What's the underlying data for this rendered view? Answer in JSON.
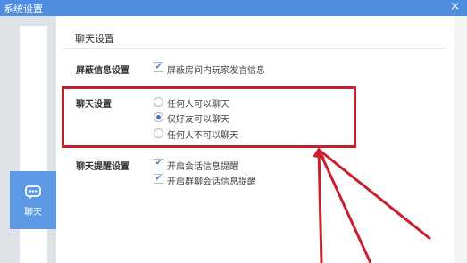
{
  "window": {
    "title": "系统设置",
    "close_icon": "×"
  },
  "sidebar": {
    "items": [
      {
        "label": "聊天",
        "icon": "chat-bubble-icon",
        "selected": true
      }
    ]
  },
  "panel": {
    "title": "聊天设置",
    "settings": {
      "block_label": "屏蔽信息设置",
      "block_option": {
        "label": "屏蔽房间内玩家发言信息",
        "checked": true
      },
      "chat_label": "聊天设置",
      "chat_options": [
        {
          "label": "任何人可以聊天",
          "checked": false
        },
        {
          "label": "仅好友可以聊天",
          "checked": true
        },
        {
          "label": "任何人不可以聊天",
          "checked": false
        }
      ],
      "reminder_label": "聊天提醒设置",
      "reminder_options": [
        {
          "label": "开启会话信息提醒",
          "checked": true
        },
        {
          "label": "开启群聊会话信息提醒",
          "checked": true
        }
      ]
    }
  },
  "colors": {
    "accent": "#4f8ede",
    "annotation": "#c8202e"
  }
}
